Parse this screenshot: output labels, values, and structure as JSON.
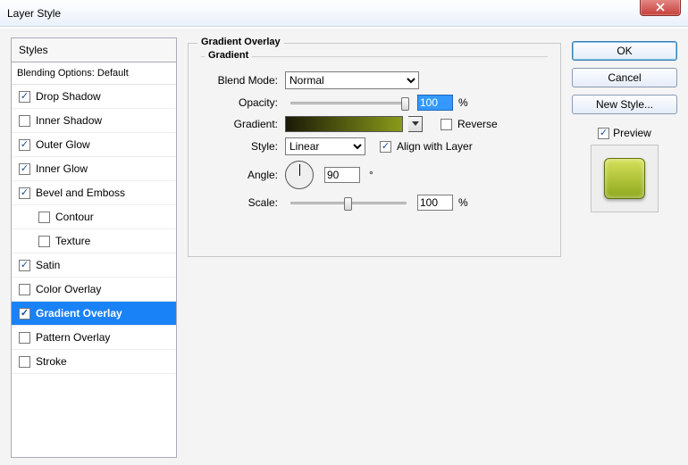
{
  "window": {
    "title": "Layer Style"
  },
  "styles_panel": {
    "header": "Styles",
    "blending": "Blending Options: Default",
    "items": [
      {
        "label": "Drop Shadow",
        "checked": true,
        "indent": false
      },
      {
        "label": "Inner Shadow",
        "checked": false,
        "indent": false
      },
      {
        "label": "Outer Glow",
        "checked": true,
        "indent": false
      },
      {
        "label": "Inner Glow",
        "checked": true,
        "indent": false
      },
      {
        "label": "Bevel and Emboss",
        "checked": true,
        "indent": false
      },
      {
        "label": "Contour",
        "checked": false,
        "indent": true
      },
      {
        "label": "Texture",
        "checked": false,
        "indent": true
      },
      {
        "label": "Satin",
        "checked": true,
        "indent": false
      },
      {
        "label": "Color Overlay",
        "checked": false,
        "indent": false
      },
      {
        "label": "Gradient Overlay",
        "checked": true,
        "indent": false,
        "selected": true
      },
      {
        "label": "Pattern Overlay",
        "checked": false,
        "indent": false
      },
      {
        "label": "Stroke",
        "checked": false,
        "indent": false
      }
    ]
  },
  "gradient_overlay": {
    "group_title": "Gradient Overlay",
    "sub_title": "Gradient",
    "blend_mode_label": "Blend Mode:",
    "blend_mode_value": "Normal",
    "opacity_label": "Opacity:",
    "opacity_value": "100",
    "opacity_unit": "%",
    "gradient_label": "Gradient:",
    "reverse_label": "Reverse",
    "reverse_checked": false,
    "style_label": "Style:",
    "style_value": "Linear",
    "align_label": "Align with Layer",
    "align_checked": true,
    "angle_label": "Angle:",
    "angle_value": "90",
    "angle_unit": "°",
    "scale_label": "Scale:",
    "scale_value": "100",
    "scale_unit": "%",
    "gradient_stops": [
      "#1a1a06",
      "#8a9a1a"
    ]
  },
  "buttons": {
    "ok": "OK",
    "cancel": "Cancel",
    "new_style": "New Style...",
    "preview_label": "Preview",
    "preview_checked": true
  }
}
